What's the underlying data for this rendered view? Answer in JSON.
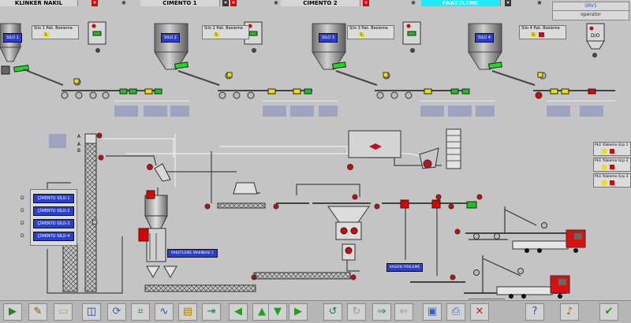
{
  "tabs": [
    {
      "label": "KLINKER NAKIL"
    },
    {
      "label": "CIMENTO 1"
    },
    {
      "label": "CIMENTO 2"
    },
    {
      "label": "PAKETLEME"
    }
  ],
  "user": {
    "line1": "SRV1",
    "line2": "operator"
  },
  "silos": [
    {
      "label": "SILO 1",
      "feed": "Silo 1 Pak. Besleme",
      "badge": "L"
    },
    {
      "label": "SILO 2",
      "feed": "Silo 2 Pak. Besleme",
      "badge": "L"
    },
    {
      "label": "SILO 3",
      "feed": "Silo 3 Pak. Besleme",
      "badge": "L"
    },
    {
      "label": "SILO 4",
      "feed": "Silo 4 Pak. Besleme",
      "badge": "L"
    }
  ],
  "dxd_label": "D/O",
  "silo_list": [
    {
      "label": "ÇİMENTO SİLO-1",
      "mark": "D"
    },
    {
      "label": "ÇİMENTO SİLO-2",
      "mark": "D"
    },
    {
      "label": "ÇİMENTO SİLO-3",
      "mark": "D"
    },
    {
      "label": "ÇİMENTO SİLO-4",
      "mark": "D"
    }
  ],
  "elevator_marks": [
    "A",
    "A",
    "B"
  ],
  "machine_label": "PAKETLEME MAKİNASI 1",
  "wagon_label": "VAGON YÜKLEME",
  "loading_groups": [
    {
      "label": "Pk1 Yükleme Grp 1"
    },
    {
      "label": "Pk1 Yükleme Grp 2"
    },
    {
      "label": "Pk1 Yükleme Grp 3"
    }
  ],
  "toolbar": [
    {
      "name": "play-icon",
      "glyph": "▶",
      "color": "#1a8a1a"
    },
    {
      "name": "tools-icon",
      "glyph": "✎",
      "color": "#7a5a00"
    },
    {
      "name": "folder-icon",
      "glyph": "▭",
      "color": "#d8a800"
    },
    {
      "name": "report-icon",
      "glyph": "◫",
      "color": "#2040a0"
    },
    {
      "name": "refresh-icon",
      "glyph": "⟳",
      "color": "#3060c0"
    },
    {
      "name": "chart-icon",
      "glyph": "⌗",
      "color": "#208020"
    },
    {
      "name": "trend-icon",
      "glyph": "∿",
      "color": "#2050c0"
    },
    {
      "name": "doc-icon",
      "glyph": "▤",
      "color": "#b08000"
    },
    {
      "name": "export-icon",
      "glyph": "⇥",
      "color": "#208040"
    },
    {
      "name": "arrow-left-icon",
      "glyph": "◀",
      "color": "#20a020"
    },
    {
      "name": "arrow-up-icon",
      "glyph": "▲",
      "color": "#20a020"
    },
    {
      "name": "arrow-down-icon",
      "glyph": "▼",
      "color": "#20a020"
    },
    {
      "name": "arrow-right-icon",
      "glyph": "▶",
      "color": "#20a020"
    },
    {
      "name": "undo-icon",
      "glyph": "↺",
      "color": "#208040"
    },
    {
      "name": "redo-icon",
      "glyph": "↻",
      "color": "#9a9a9a"
    },
    {
      "name": "forward-icon",
      "glyph": "⇒",
      "color": "#208040"
    },
    {
      "name": "back-icon",
      "glyph": "⇐",
      "color": "#9a9a9a"
    },
    {
      "name": "screens-icon",
      "glyph": "▣",
      "color": "#3060c0"
    },
    {
      "name": "print-icon",
      "glyph": "⎙",
      "color": "#3060c0"
    },
    {
      "name": "delete-icon",
      "glyph": "✕",
      "color": "#c02020"
    },
    {
      "name": "help-icon",
      "glyph": "?",
      "color": "#2050c0"
    },
    {
      "name": "sound-icon",
      "glyph": "♪",
      "color": "#a06000"
    },
    {
      "name": "confirm-icon",
      "glyph": "✔",
      "color": "#209020"
    }
  ],
  "colors": {
    "bg": "#c4c4c4",
    "belt": "#5a5a5a",
    "running": "#20c020",
    "alarm": "#e00000",
    "warning": "#f0e000",
    "label_blue": "#2a3fd0",
    "panel": "#dcdcdc"
  }
}
